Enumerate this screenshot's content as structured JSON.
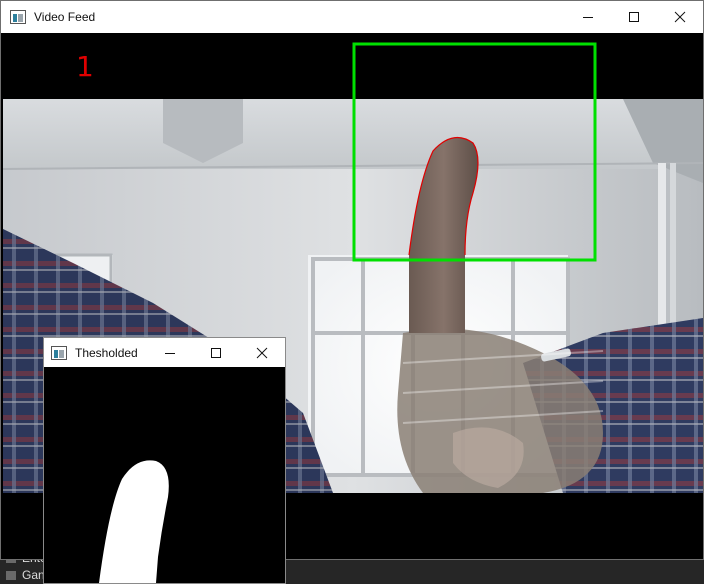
{
  "taskbar": {
    "items": [
      "Ente",
      "Gan"
    ]
  },
  "main_window": {
    "title": "Video Feed",
    "icons": [
      "app-icon",
      "minimize-icon",
      "maximize-icon",
      "close-icon"
    ],
    "overlay_count": "1",
    "overlay_color": "#e00000",
    "roi_box_color": "#00e000",
    "contour_color": "#e00000"
  },
  "threshold_window": {
    "title": "Thesholded",
    "icons": [
      "app-icon",
      "minimize-icon",
      "maximize-icon",
      "close-icon"
    ]
  }
}
